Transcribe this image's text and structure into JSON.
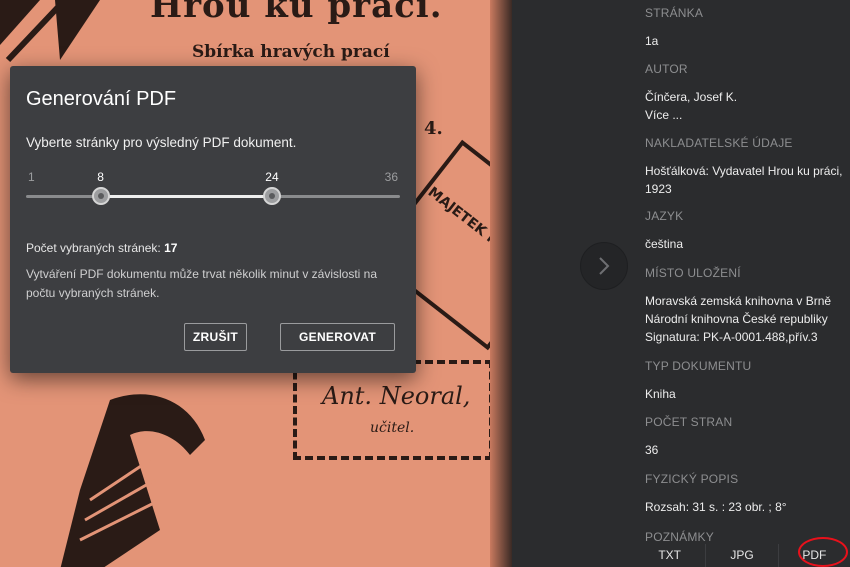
{
  "viewer": {
    "page_title": "Hrou ku práci.",
    "page_subtitle": "Sbírka hravých prací",
    "page_number": "4.",
    "stamp_text": "MAJETEK NEORAL",
    "signature": "Ant. Neoral,",
    "signature_role": "učitel."
  },
  "dialog": {
    "title": "Generování PDF",
    "description": "Vyberte stránky pro výsledný PDF dokument.",
    "slider": {
      "min": 1,
      "max": 36,
      "from": 8,
      "to": 24,
      "min_label": "1",
      "from_label": "8",
      "to_label": "24",
      "max_label": "36"
    },
    "count_label": "Počet vybraných stránek:",
    "count_value": "17",
    "note": "Vytváření PDF dokumentu může trvat několik minut v závislosti na počtu vybraných stránek.",
    "cancel_label": "ZRUŠIT",
    "generate_label": "GENEROVAT"
  },
  "panel": {
    "fields": [
      {
        "label": "STRÁNKA",
        "value": "1a"
      },
      {
        "label": "AUTOR",
        "value": "Čínčera, Josef K.",
        "more": "Více ..."
      },
      {
        "label": "NAKLADATELSKÉ ÚDAJE",
        "value": "Hošťálková: Vydavatel Hrou ku práci, 1923"
      },
      {
        "label": "JAZYK",
        "value": "čeština"
      },
      {
        "label": "MÍSTO ULOŽENÍ",
        "lines": [
          "Moravská zemská knihovna v Brně",
          "Národní knihovna České republiky",
          "Signatura: PK-A-0001.488,přív.3"
        ]
      },
      {
        "label": "TYP DOKUMENTU",
        "value": "Kniha"
      },
      {
        "label": "POČET STRAN",
        "value": "36"
      },
      {
        "label": "FYZICKÝ POPIS",
        "value": "Rozsah: 31 s. : 23 obr. ; 8°"
      },
      {
        "label": "POZNÁMKY"
      }
    ],
    "downloads": [
      "TXT",
      "JPG",
      "PDF"
    ]
  },
  "colors": {
    "panel_bg": "#2b2c2e",
    "dialog_bg": "#3d3e41",
    "scan_paper": "#e39477",
    "highlight": "#e8111b"
  }
}
